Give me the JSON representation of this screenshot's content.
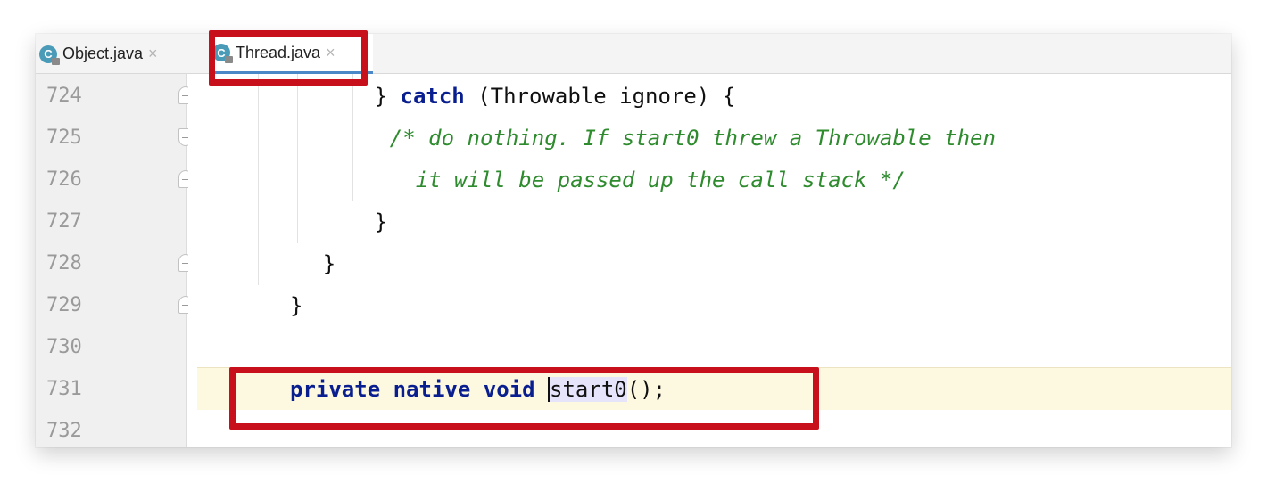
{
  "tabs": [
    {
      "label": "Object.java",
      "icon": "C",
      "close": "×",
      "active": false
    },
    {
      "label": "Thread.java",
      "icon": "C",
      "close": "×",
      "active": true
    }
  ],
  "gutter": {
    "lines": [
      "724",
      "725",
      "726",
      "727",
      "728",
      "729",
      "730",
      "731",
      "732"
    ],
    "current_line": "731"
  },
  "code": {
    "line724": {
      "pre": "        } ",
      "kw": "catch",
      "post": " (Throwable ignore) {"
    },
    "line725": {
      "comment": "    /* do nothing. If start0 threw a Throwable then"
    },
    "line726": {
      "comment": "      it will be passed up the call stack */"
    },
    "line727": {
      "text": "        }"
    },
    "line728": {
      "text": "    }"
    },
    "line729": {
      "text": "}"
    },
    "line731": {
      "kw1": "private",
      "kw2": "native",
      "kw3": "void",
      "method": "start0",
      "tail": "();"
    }
  },
  "colors": {
    "highlight_box": "#c8101c",
    "keyword": "#0a1f8f",
    "comment": "#2e8b2e",
    "current_line": "#fdf8e0",
    "active_tab_underline": "#4a88c7"
  }
}
